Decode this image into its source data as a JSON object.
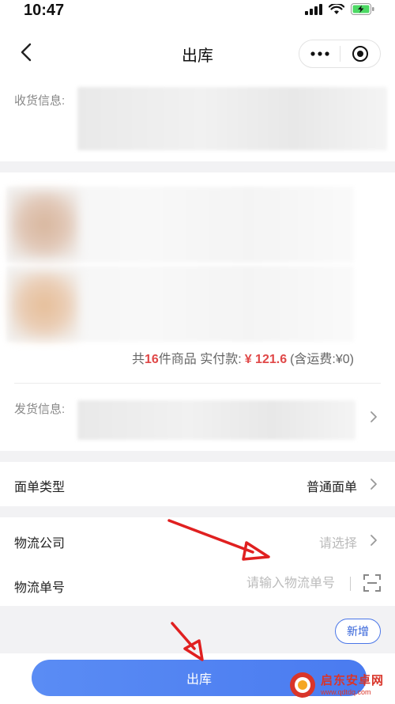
{
  "status_bar": {
    "time": "10:47"
  },
  "nav": {
    "title": "出库"
  },
  "receive": {
    "label": "收货信息:"
  },
  "goods_summary": {
    "prefix": "共",
    "count": "16",
    "unit_text": "件商品 实付款:",
    "price": "¥ 121.6",
    "shipping": "(含运费:¥0)"
  },
  "ship": {
    "label": "发货信息:"
  },
  "waybill_type": {
    "label": "面单类型",
    "value": "普通面单"
  },
  "logistics_company": {
    "label": "物流公司",
    "placeholder": "请选择"
  },
  "tracking_number": {
    "label": "物流单号",
    "placeholder": "请输入物流单号"
  },
  "add_button": {
    "label": "新增"
  },
  "submit_button": {
    "label": "出库"
  },
  "watermark": {
    "name": "启东安卓网",
    "url": "www.qdtdq.com"
  },
  "colors": {
    "primary": "#4a7bf0",
    "price_red": "#e04848",
    "annotation_red": "#e02020",
    "watermark_red": "#d9352a"
  }
}
